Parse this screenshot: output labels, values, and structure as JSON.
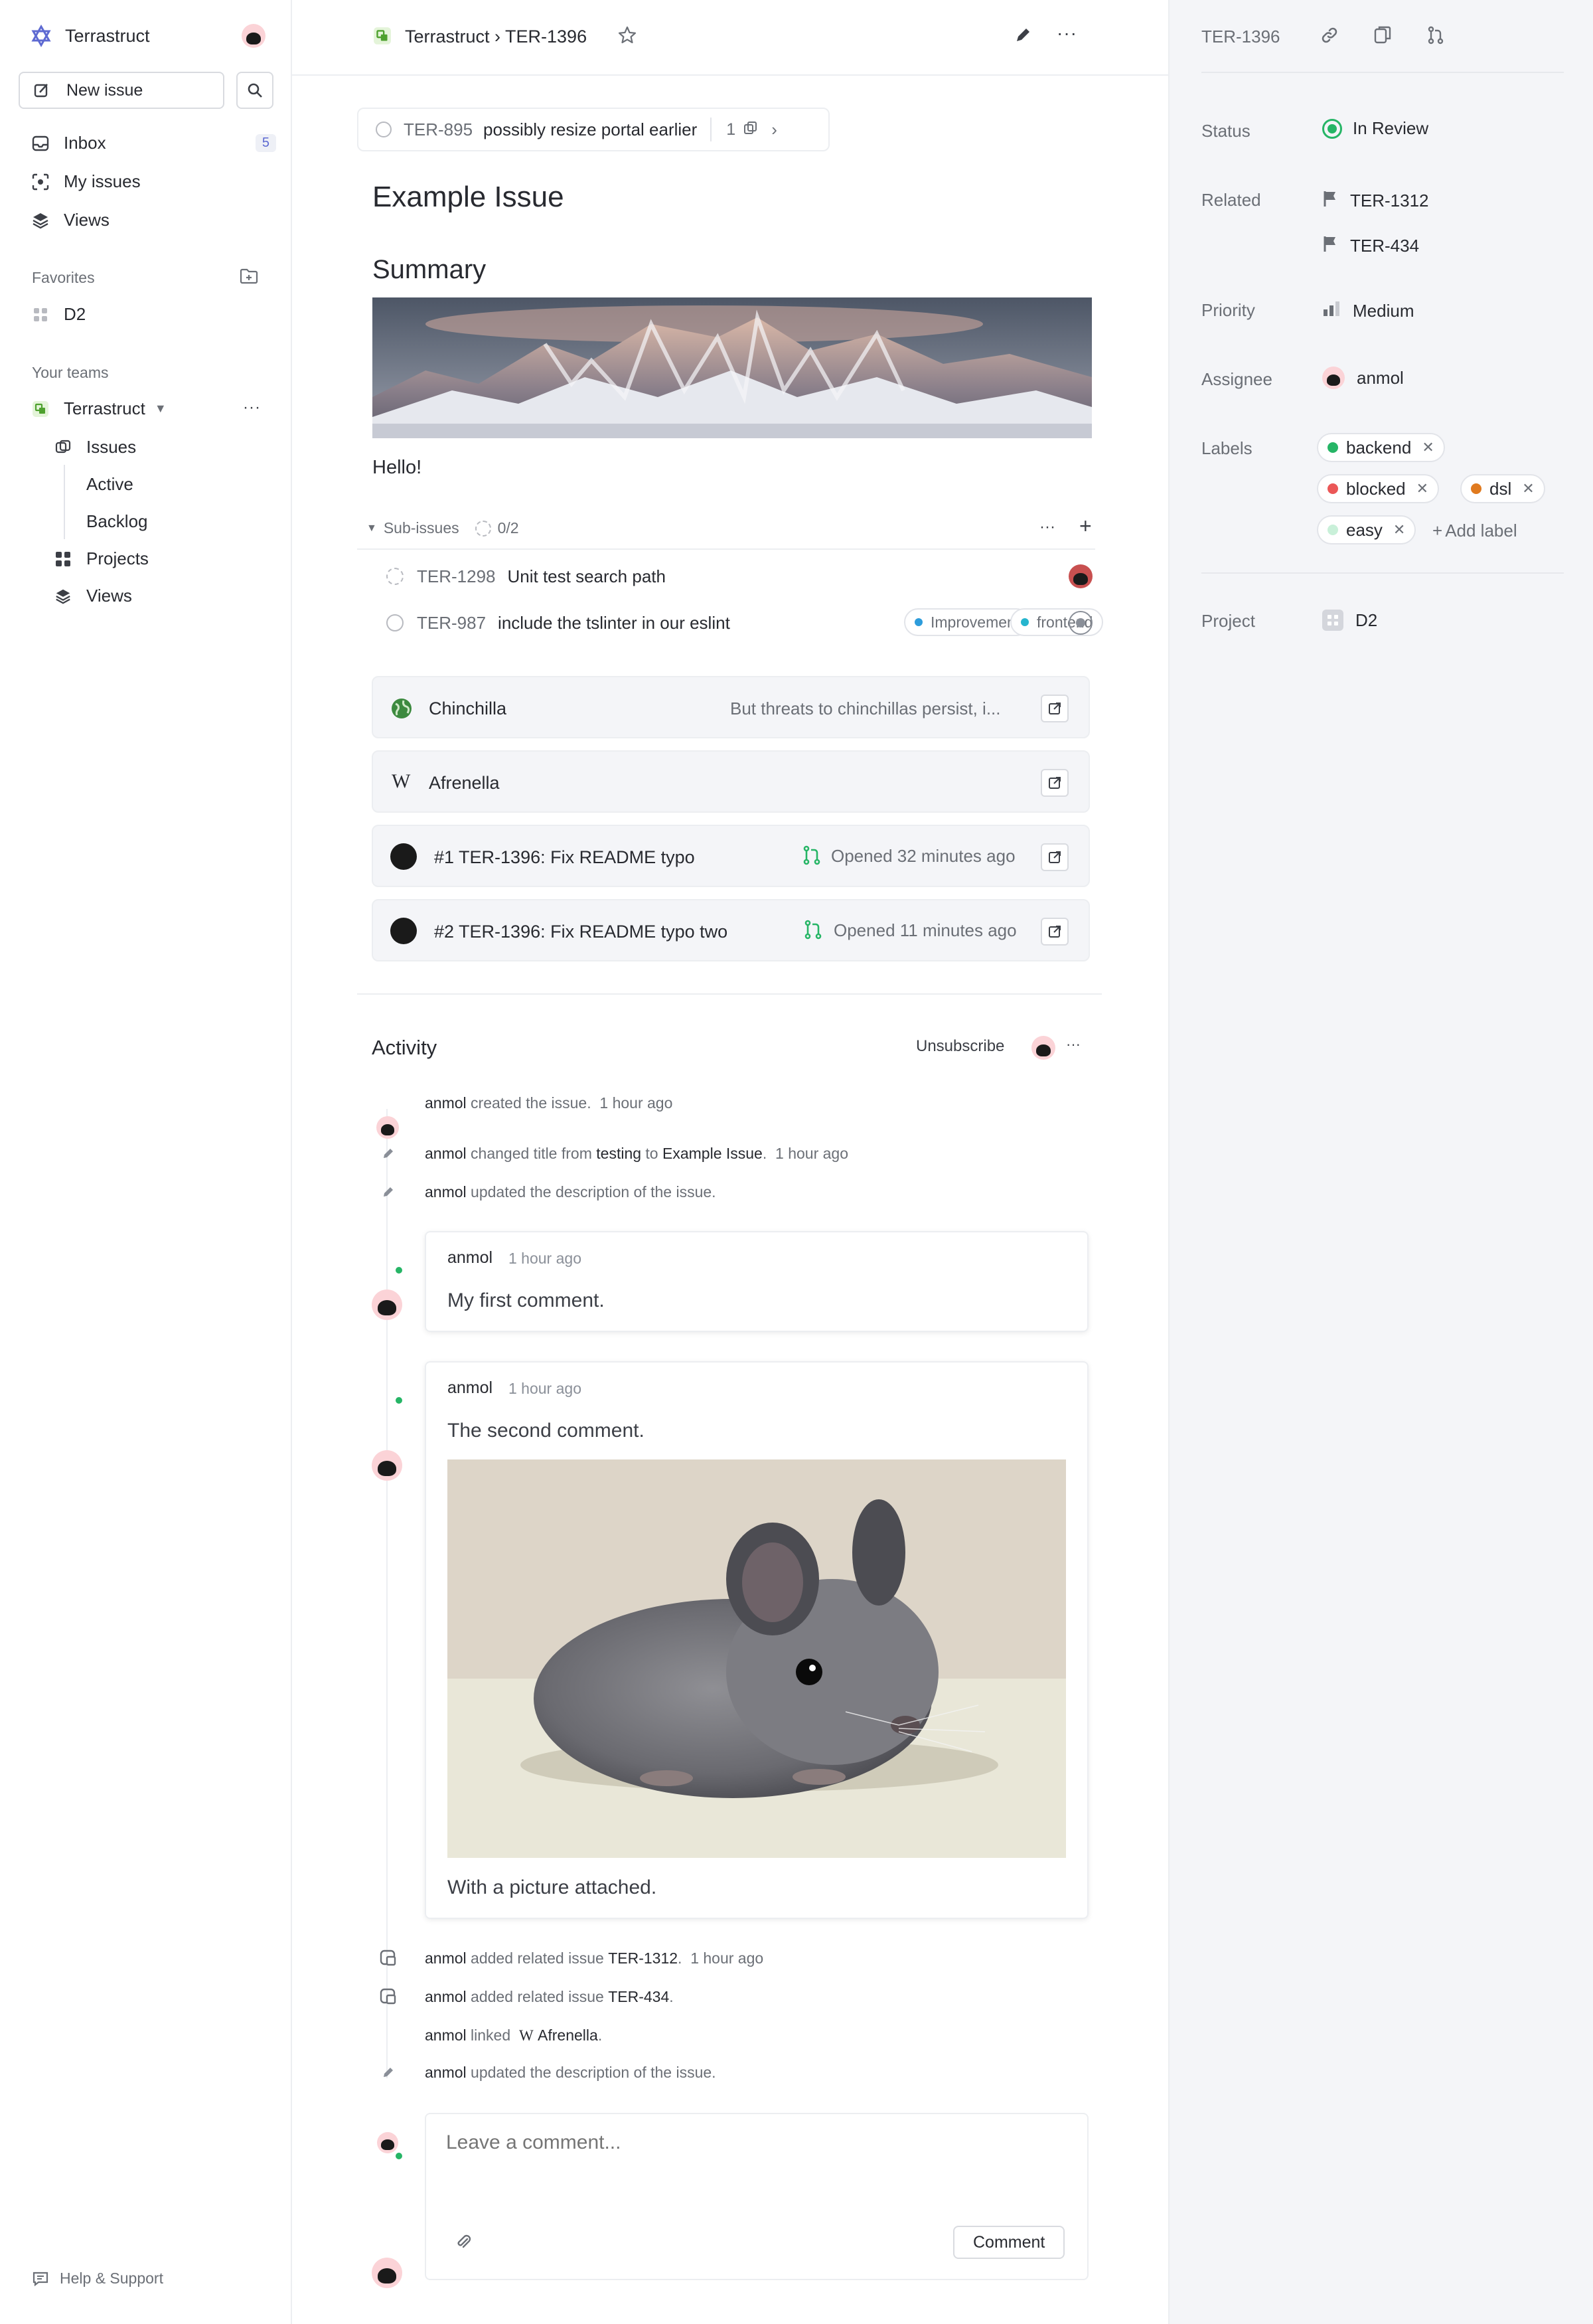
{
  "workspace": {
    "name": "Terrastruct"
  },
  "sidebar": {
    "new_issue_label": "New issue",
    "nav": [
      {
        "label": "Inbox",
        "count": "5"
      },
      {
        "label": "My issues"
      },
      {
        "label": "Views"
      }
    ],
    "favorites_label": "Favorites",
    "favorites": [
      {
        "label": "D2"
      }
    ],
    "teams_label": "Your teams",
    "team": {
      "name": "Terrastruct",
      "items": [
        "Issues",
        "Active",
        "Backlog",
        "Projects",
        "Views"
      ]
    },
    "help_label": "Help & Support"
  },
  "topbar": {
    "breadcrumb": "Terrastruct › TER-1396"
  },
  "parent": {
    "id": "TER-895",
    "title": "possibly resize portal earlier",
    "count": "1"
  },
  "issue": {
    "title": "Example Issue",
    "summary_heading": "Summary",
    "body_text": "Hello!"
  },
  "subissues": {
    "label": "Sub-issues",
    "progress": "0/2",
    "items": [
      {
        "id": "TER-1298",
        "title": "Unit test search path"
      },
      {
        "id": "TER-987",
        "title": "include the tslinter in our eslint",
        "labels": [
          "Improvement",
          "frontend"
        ]
      }
    ]
  },
  "links": [
    {
      "title": "Chinchilla",
      "preview": "But threats to chinchillas persist, i..."
    },
    {
      "title": "Afrenella",
      "icon": "W"
    },
    {
      "title": "#1 TER-1396: Fix README typo",
      "status": "Opened 32 minutes ago"
    },
    {
      "title": "#2 TER-1396: Fix README typo two",
      "status": "Opened 11 minutes ago"
    }
  ],
  "activity": {
    "heading": "Activity",
    "unsubscribe": "Unsubscribe",
    "events": [
      {
        "user": "anmol",
        "text": "created the issue.",
        "time": "1 hour ago"
      },
      {
        "user": "anmol",
        "text": "changed title from",
        "from": "testing",
        "to_word": "to",
        "to": "Example Issue",
        "time": "1 hour ago"
      },
      {
        "user": "anmol",
        "text": "updated the description of the issue."
      }
    ],
    "comments": [
      {
        "user": "anmol",
        "time": "1 hour ago",
        "text": "My first comment."
      },
      {
        "user": "anmol",
        "time": "1 hour ago",
        "text": "The second comment.",
        "caption": "With a picture attached."
      }
    ],
    "events2": [
      {
        "user": "anmol",
        "text": "added related issue",
        "ref": "TER-1312",
        "time": "1 hour ago"
      },
      {
        "user": "anmol",
        "text": "added related issue",
        "ref": "TER-434"
      },
      {
        "user": "anmol",
        "text": "linked",
        "ref": "Afrenella"
      },
      {
        "user": "anmol",
        "text": "updated the description of the issue."
      }
    ],
    "comment_placeholder": "Leave a comment...",
    "comment_button": "Comment"
  },
  "right": {
    "id": "TER-1396",
    "status_label": "Status",
    "status": "In Review",
    "related_label": "Related",
    "related": [
      "TER-1312",
      "TER-434"
    ],
    "priority_label": "Priority",
    "priority": "Medium",
    "assignee_label": "Assignee",
    "assignee": "anmol",
    "labels_label": "Labels",
    "labels": [
      {
        "name": "backend",
        "color": "#26b566"
      },
      {
        "name": "blocked",
        "color": "#eb5757"
      },
      {
        "name": "dsl",
        "color": "#e07a1f"
      },
      {
        "name": "easy",
        "color": "#c9f0d9"
      }
    ],
    "add_label": "Add label",
    "project_label": "Project",
    "project": "D2"
  },
  "colors": {
    "accent": "#5e6ad2",
    "status_green": "#26b566"
  }
}
